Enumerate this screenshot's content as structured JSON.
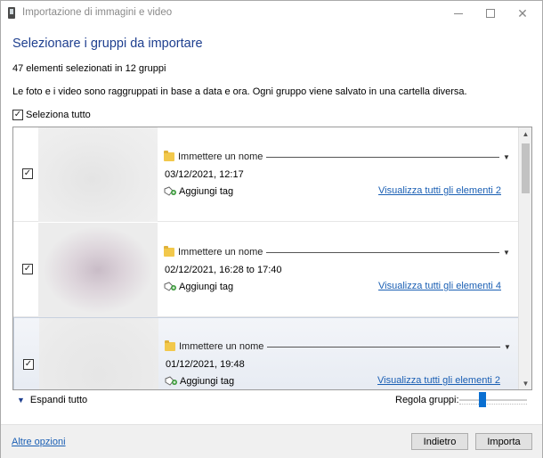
{
  "window": {
    "title": "Importazione di immagini e video",
    "controls": {
      "minimize": "minimize-icon",
      "maximize": "maximize-icon",
      "close": "close-icon"
    }
  },
  "header": {
    "heading": "Selezionare i gruppi da importare",
    "count_text": "47 elementi selezionati in 12 gruppi",
    "description": "Le foto e i video sono raggruppati in base a data e ora. Ogni gruppo viene salvato in una cartella diversa."
  },
  "select_all": {
    "label": "Seleziona tutto",
    "checked": true
  },
  "groups": [
    {
      "checked": true,
      "name_placeholder": "Immettere un nome",
      "date": "03/12/2021, 12:17",
      "tag_label": "Aggiungi tag",
      "view_link": "Visualizza tutti gli elementi 2",
      "selected": false
    },
    {
      "checked": true,
      "name_placeholder": "Immettere un nome",
      "date": "02/12/2021, 16:28 to 17:40",
      "tag_label": "Aggiungi tag",
      "view_link": "Visualizza tutti gli elementi 4",
      "selected": false
    },
    {
      "checked": true,
      "name_placeholder": "Immettere un nome",
      "date": "01/12/2021, 19:48",
      "tag_label": "Aggiungi tag",
      "view_link": "Visualizza tutti gli elementi 2",
      "selected": true
    }
  ],
  "bottom_controls": {
    "expand_all": "Espandi tutto",
    "adjust_groups": "Regola gruppi:"
  },
  "footer": {
    "more_options": "Altre opzioni",
    "back_button": "Indietro",
    "import_button": "Importa"
  },
  "colors": {
    "accent": "#0a6fd1",
    "heading": "#1e3f8f",
    "link": "#1a5fb4"
  }
}
